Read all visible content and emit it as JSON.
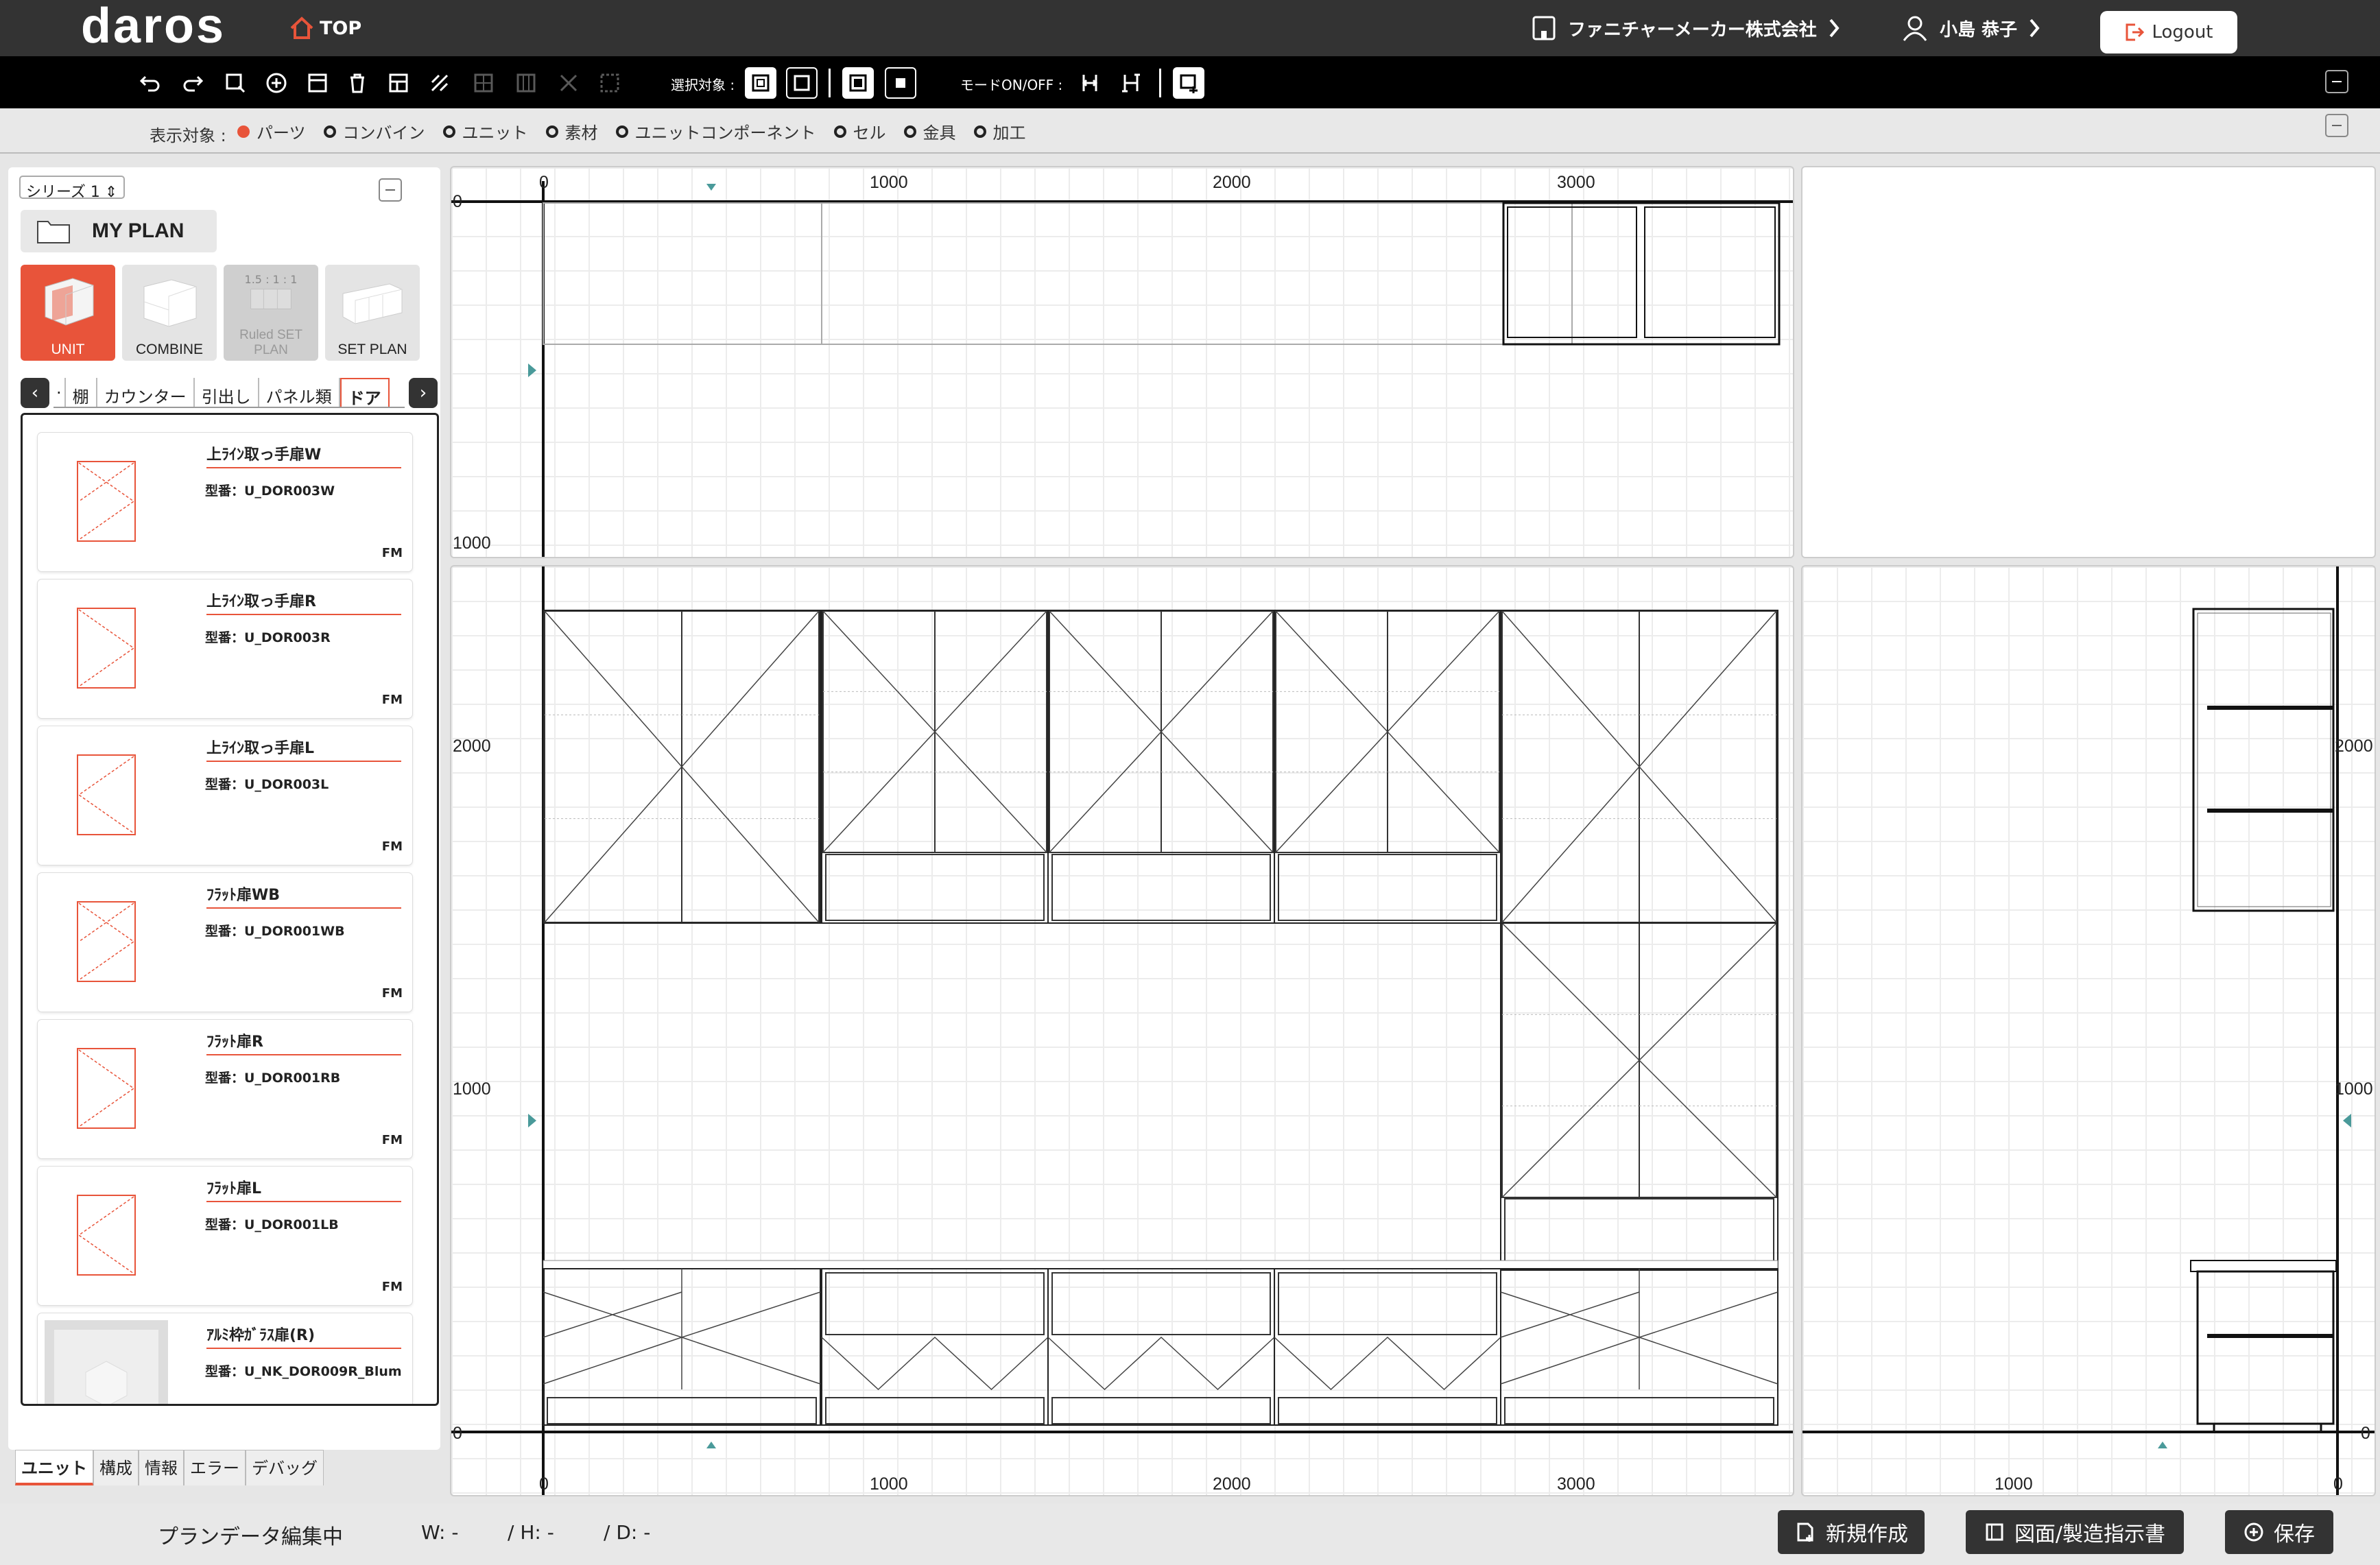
{
  "header": {
    "logo": "daros",
    "top_label": "TOP",
    "company": "ファニチャーメーカー株式会社",
    "user": "小島 恭子",
    "logout": "Logout"
  },
  "toolbar": {
    "select_label": "選択対象 :",
    "mode_label": "モードON/OFF :"
  },
  "filter": {
    "label": "表示対象 :",
    "options": [
      {
        "label": "パーツ",
        "selected": true
      },
      {
        "label": "コンバイン",
        "selected": false
      },
      {
        "label": "ユニット",
        "selected": false
      },
      {
        "label": "素材",
        "selected": false
      },
      {
        "label": "ユニットコンポーネント",
        "selected": false
      },
      {
        "label": "セル",
        "selected": false
      },
      {
        "label": "金具",
        "selected": false
      },
      {
        "label": "加工",
        "selected": false
      }
    ]
  },
  "sidebar": {
    "series": "シリーズ 1",
    "my_plan": "MY PLAN",
    "modes": [
      {
        "label": "UNIT"
      },
      {
        "label": "COMBINE"
      },
      {
        "label": "Ruled SET PLAN",
        "top": "1.5 : 1 : 1"
      },
      {
        "label": "SET PLAN"
      }
    ],
    "tabs": [
      "棚",
      "カウンター",
      "引出し",
      "パネル類",
      "ドア"
    ],
    "parts": [
      {
        "name": "上ﾗｲﾝ取っ手扉W",
        "code": "型番：U_DOR003W",
        "tag": "FM"
      },
      {
        "name": "上ﾗｲﾝ取っ手扉R",
        "code": "型番：U_DOR003R",
        "tag": "FM"
      },
      {
        "name": "上ﾗｲﾝ取っ手扉L",
        "code": "型番：U_DOR003L",
        "tag": "FM"
      },
      {
        "name": "ﾌﾗｯﾄ扉WB",
        "code": "型番：U_DOR001WB",
        "tag": "FM"
      },
      {
        "name": "ﾌﾗｯﾄ扉R",
        "code": "型番：U_DOR001RB",
        "tag": "FM"
      },
      {
        "name": "ﾌﾗｯﾄ扉L",
        "code": "型番：U_DOR001LB",
        "tag": "FM"
      },
      {
        "name": "ｱﾙﾐ枠ｶﾞﾗｽ扉(R)",
        "code": "型番：U_NK_DOR009R_Blum",
        "tag": ""
      }
    ],
    "bottom_tabs": [
      "ユニット",
      "構成",
      "情報",
      "エラー",
      "デバッグ"
    ]
  },
  "drawing": {
    "x_ticks": [
      "0",
      "1000",
      "2000",
      "3000"
    ],
    "y_ticks_top": [
      "0",
      "1000"
    ],
    "y_ticks_front": [
      "2000",
      "1000",
      "0"
    ],
    "side_ticks": [
      "1000",
      "0"
    ],
    "side_y": [
      "2000",
      "1000",
      "0"
    ]
  },
  "footer": {
    "status": "プランデータ編集中",
    "w": "W: -",
    "h": "/ H: -",
    "d": "/ D: -",
    "new_btn": "新規作成",
    "drawing_btn": "図面/製造指示書",
    "save_btn": "保存"
  }
}
